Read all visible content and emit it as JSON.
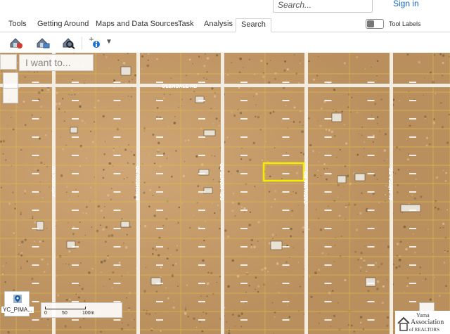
{
  "header": {
    "search_placeholder": "Search...",
    "sign_in": "Sign in"
  },
  "tabs": [
    {
      "label": "Tools",
      "active": false
    },
    {
      "label": "Getting Around",
      "active": false
    },
    {
      "label": "Maps and Data Sources",
      "active": false
    },
    {
      "label": "Task",
      "active": false
    },
    {
      "label": "Analysis",
      "active": false
    },
    {
      "label": "Search",
      "active": true
    }
  ],
  "tool_labels": {
    "label": "Tool Labels",
    "on": false
  },
  "toolbar": {
    "icons": [
      "search-by-parcel-icon",
      "search-by-address-icon",
      "search-by-owner-icon",
      "identify-icon"
    ]
  },
  "map": {
    "search_prompt": "I want to...",
    "road_labels": {
      "glendale": "GLENDALE RD",
      "arcadia": "ARCADIA RD",
      "brighton": "BRIGHTON RD",
      "delmonte": "DEL MONTE RD",
      "catalina": "CATALINA RD",
      "alameda": "ALAMEDA RD"
    },
    "highlight_color": "#f2ee00",
    "layer_label": "YC_PIMA...",
    "scale": {
      "ticks": [
        "0",
        "50",
        "100m"
      ]
    }
  },
  "logo": {
    "line1": "Yuma",
    "line2": "Association",
    "line3": "of REALTORS"
  }
}
